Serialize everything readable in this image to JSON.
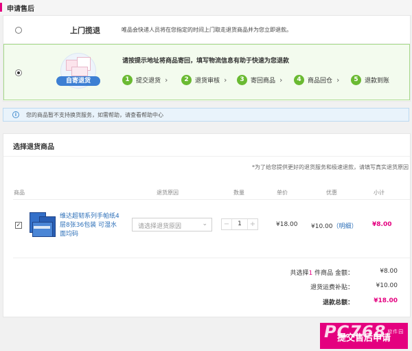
{
  "header": {
    "title": "申请售后"
  },
  "options": {
    "pickup": {
      "label": "上门揽退",
      "desc": "唯品会快递人员将在您指定的时间上门取走退货商品并为您立即退款。"
    },
    "self_ship": {
      "badge": "自寄退货",
      "headline": "请按提示地址将商品寄回，填写物流信息有助于快速为您退款",
      "steps": [
        {
          "num": "1",
          "name": "提交退货"
        },
        {
          "num": "2",
          "name": "退货审核"
        },
        {
          "num": "3",
          "name": "寄回商品"
        },
        {
          "num": "4",
          "name": "商品回仓"
        },
        {
          "num": "5",
          "name": "退款到账"
        }
      ]
    }
  },
  "info": {
    "icon": "info-icon",
    "text": "您的商品暂不支持换货服务，如需帮助，请查看帮助中心"
  },
  "products": {
    "title": "选择退货商品",
    "note": "*为了给您提供更好的退货服务和极速退款，请填写真实退货原因",
    "columns": [
      "商品",
      "退货原因",
      "数量",
      "单价",
      "优惠",
      "小计"
    ],
    "items": [
      {
        "checked": true,
        "name": "维达超韧系列手帕纸4层8张36包装 可湿水面均码",
        "reason_placeholder": "请选择退货原因",
        "qty": "1",
        "price": "¥18.00",
        "discount": "¥10.00",
        "discount_link": "（明细）",
        "subtotal": "¥8.00"
      }
    ]
  },
  "summary": {
    "selected_prefix": "共选择",
    "selected_count": "1",
    "selected_suffix": " 件商品 金额：",
    "amount": "¥8.00",
    "shipping_label": "退货运费补贴：",
    "shipping": "¥10.00",
    "total_label": "退款总额：",
    "total": "¥18.00"
  },
  "submit_label": "提交售后申请",
  "watermark": {
    "text": "PC768",
    "sub": "软件园"
  },
  "colors": {
    "accent": "#e4007f",
    "step_green": "#6aba32",
    "link_blue": "#2c6fb8"
  }
}
